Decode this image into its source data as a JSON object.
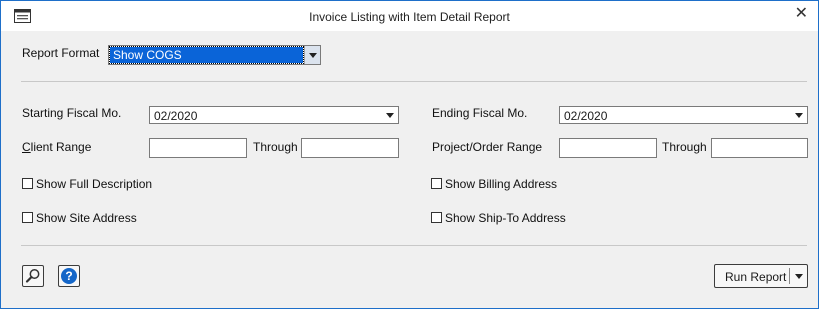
{
  "window": {
    "title": "Invoice Listing with Item Detail Report",
    "app_icon": "report-window-icon",
    "close_glyph": "✕"
  },
  "report_format": {
    "label": "Report Format",
    "value": "Show COGS"
  },
  "fiscal": {
    "starting_label": "Starting Fiscal Mo.",
    "starting_value": "02/2020",
    "ending_label": "Ending Fiscal Mo.",
    "ending_value": "02/2020"
  },
  "client_range": {
    "label_first": "C",
    "label_rest": "lient Range",
    "from": "",
    "through_label": "Through",
    "to": ""
  },
  "project_range": {
    "label": "Project/Order Range",
    "from": "",
    "through_label": "Through",
    "to": ""
  },
  "options": {
    "full_description": {
      "label": "Show Full Description",
      "checked": false
    },
    "site_address": {
      "label": "Show Site Address",
      "checked": false
    },
    "billing_address": {
      "label": "Show Billing Address",
      "checked": false
    },
    "ship_to_address": {
      "label": "Show Ship-To Address",
      "checked": false
    }
  },
  "footer": {
    "preview_icon": "magnifier-icon",
    "help_icon": "help-icon",
    "run_label": "Run Report"
  },
  "colors": {
    "accent": "#0a64d8",
    "help_blue": "#1466c8",
    "window_border": "#1e6fc9"
  }
}
